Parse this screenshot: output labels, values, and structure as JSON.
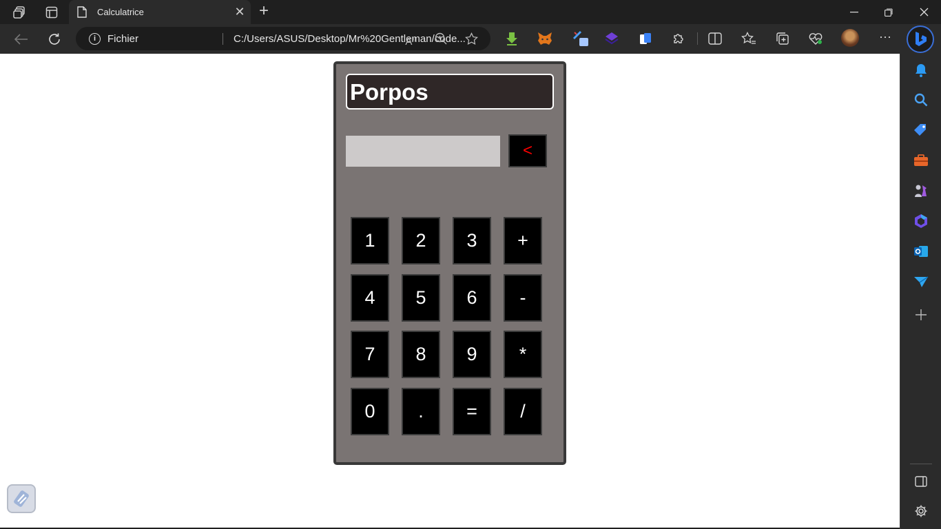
{
  "browser": {
    "tab_title": "Calculatrice",
    "address_scheme": "Fichier",
    "address_url": "C:/Users/ASUS/Desktop/Mr%20Gentleman/code..."
  },
  "calculator": {
    "title": "Porpos",
    "display_value": "",
    "backspace_label": "<",
    "keys": [
      "1",
      "2",
      "3",
      "+",
      "4",
      "5",
      "6",
      "-",
      "7",
      "8",
      "9",
      "*",
      "0",
      ".",
      "=",
      "/"
    ]
  }
}
